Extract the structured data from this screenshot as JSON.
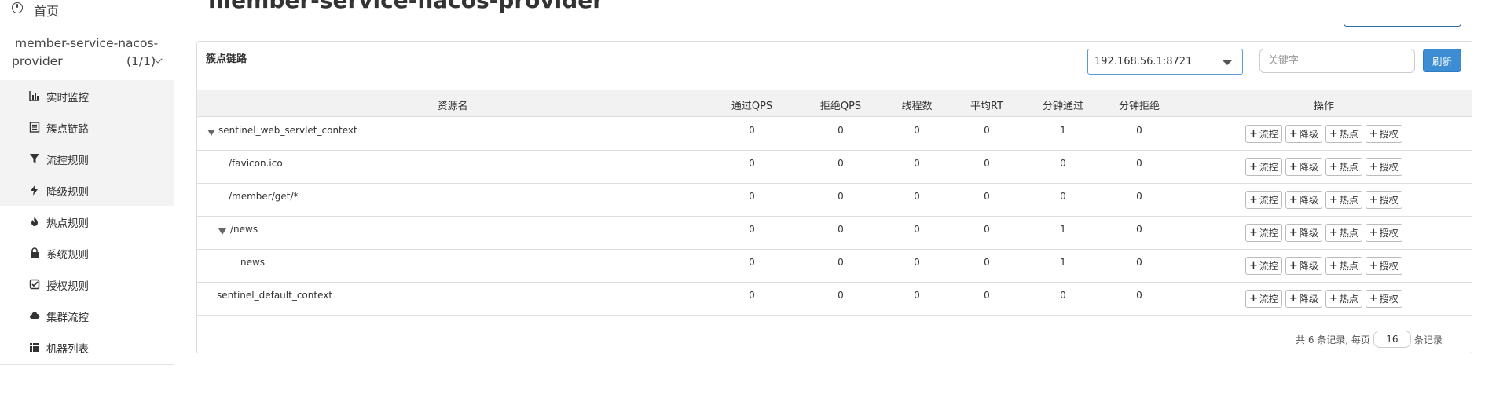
{
  "sidebar": {
    "home_label": "首页",
    "app": {
      "name_line1": "member-service-nacos-",
      "name_line2": "provider",
      "count": "(1/1)"
    },
    "items": [
      {
        "label": "实时监控",
        "icon": "bar-chart-icon"
      },
      {
        "label": "簇点链路",
        "icon": "list-icon"
      },
      {
        "label": "流控规则",
        "icon": "filter-icon"
      },
      {
        "label": "降级规则",
        "icon": "bolt-icon"
      },
      {
        "label": "热点规则",
        "icon": "fire-icon"
      },
      {
        "label": "系统规则",
        "icon": "lock-icon"
      },
      {
        "label": "授权规则",
        "icon": "check-square-icon"
      },
      {
        "label": "集群流控",
        "icon": "cloud-icon"
      },
      {
        "label": "机器列表",
        "icon": "grid-list-icon"
      }
    ]
  },
  "header": {
    "title": "member-service-nacos-provider"
  },
  "panel": {
    "title": "簇点链路",
    "machine": "192.168.56.1:8721",
    "keyword_placeholder": "关键字",
    "refresh_label": "刷新"
  },
  "table": {
    "columns": {
      "name": "资源名",
      "pass_qps": "通过QPS",
      "block_qps": "拒绝QPS",
      "threads": "线程数",
      "avg_rt": "平均RT",
      "minute_pass": "分钟通过",
      "minute_block": "分钟拒绝",
      "ops": "操作"
    },
    "op_labels": {
      "flow": "流控",
      "degrade": "降级",
      "hot": "热点",
      "auth": "授权"
    },
    "rows": [
      {
        "name": "sentinel_web_servlet_context",
        "pass_qps": "0",
        "block_qps": "0",
        "threads": "0",
        "avg_rt": "0",
        "minute_pass": "1",
        "minute_block": "0"
      },
      {
        "name": "/favicon.ico",
        "pass_qps": "0",
        "block_qps": "0",
        "threads": "0",
        "avg_rt": "0",
        "minute_pass": "0",
        "minute_block": "0"
      },
      {
        "name": "/member/get/*",
        "pass_qps": "0",
        "block_qps": "0",
        "threads": "0",
        "avg_rt": "0",
        "minute_pass": "0",
        "minute_block": "0"
      },
      {
        "name": "/news",
        "pass_qps": "0",
        "block_qps": "0",
        "threads": "0",
        "avg_rt": "0",
        "minute_pass": "1",
        "minute_block": "0"
      },
      {
        "name": "news",
        "pass_qps": "0",
        "block_qps": "0",
        "threads": "0",
        "avg_rt": "0",
        "minute_pass": "1",
        "minute_block": "0"
      },
      {
        "name": "sentinel_default_context",
        "pass_qps": "0",
        "block_qps": "0",
        "threads": "0",
        "avg_rt": "0",
        "minute_pass": "0",
        "minute_block": "0"
      }
    ]
  },
  "pager": {
    "prefix": "共 6 条记录, 每页",
    "page_size": "16",
    "suffix": "条记录"
  }
}
